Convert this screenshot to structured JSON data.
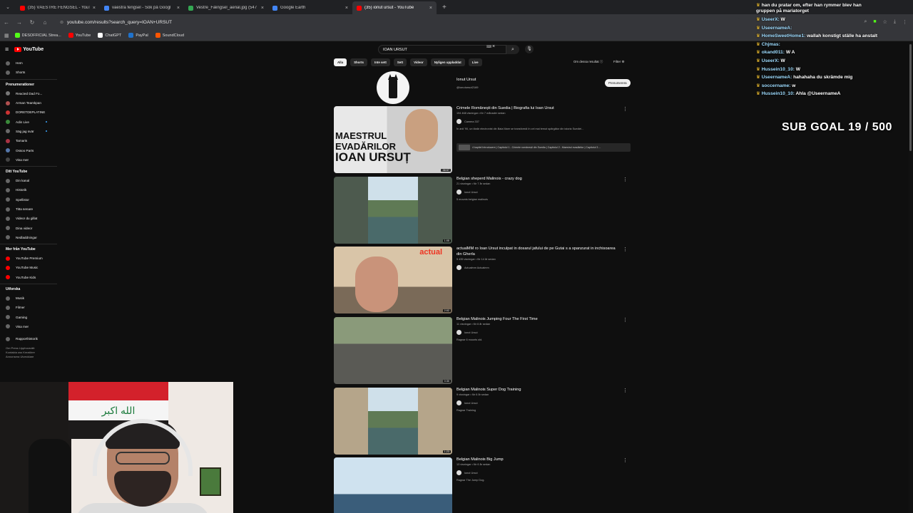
{
  "browser": {
    "tabs": [
      {
        "label": "(35) VÄESTRE FENGSEL - YouTu",
        "color": "#ff0000",
        "active": false
      },
      {
        "label": "vaestra fengsel - Sök på Googl",
        "color": "#4285f4",
        "active": false
      },
      {
        "label": "Vestre_Fængsel_aerial.jpg (547",
        "color": "#34a853",
        "active": false
      },
      {
        "label": "Google Earth",
        "color": "#4285f4",
        "active": false
      },
      {
        "label": "(35) ionut ursut - YouTube",
        "color": "#ff0000",
        "active": true
      }
    ],
    "new_tab": "+",
    "url": "youtube.com/results?search_query=IOAN+URSUT",
    "bookmarks": [
      {
        "label": "DESOFFICIAL Strea...",
        "color": "#53fc18"
      },
      {
        "label": "YouTube",
        "color": "#ff0000"
      },
      {
        "label": "ChatGPT",
        "color": "#ffffff"
      },
      {
        "label": "PayPal",
        "color": "#1f72cc"
      },
      {
        "label": "SoundCloud",
        "color": "#ff5500"
      }
    ]
  },
  "youtube": {
    "logo": "YouTube",
    "search_value": "IOAN URSUT",
    "sidebar_top": [
      {
        "label": "Hem"
      },
      {
        "label": "Shorts"
      }
    ],
    "subs_heading": "Prenumerationer",
    "subs": [
      {
        "label": "Reacted Dad Fo...",
        "color": "#777777"
      },
      {
        "label": "Arman Teamkpan",
        "color": "#b05050"
      },
      {
        "label": "DORETDEPLATINE",
        "color": "#cc3333"
      },
      {
        "label": "Adin Live",
        "color": "#3a8a3a"
      },
      {
        "label": "Säg jag svär",
        "color": "#6a6a6a"
      },
      {
        "label": "Tamaris",
        "color": "#aa3344"
      },
      {
        "label": "Ossoo Parts",
        "color": "#5577aa"
      },
      {
        "label": "Visa mer",
        "color": "#444444"
      }
    ],
    "you_heading": "Ditt YouTube",
    "you_items": [
      {
        "label": "Din kanal"
      },
      {
        "label": "Historik"
      },
      {
        "label": "Spellistor"
      },
      {
        "label": "Titta senare"
      },
      {
        "label": "Videor du gillat"
      },
      {
        "label": "Dina videor"
      },
      {
        "label": "Nedladdningar"
      }
    ],
    "more_heading": "Mer från YouTube",
    "more_items": [
      {
        "label": "YouTube Premium"
      },
      {
        "label": "YouTube Music"
      },
      {
        "label": "YouTube Kids"
      }
    ],
    "explore_heading": "Utforska",
    "explore_items": [
      {
        "label": "Musik"
      },
      {
        "label": "Filmer"
      },
      {
        "label": "Gaming"
      },
      {
        "label": "Visa mer"
      }
    ],
    "report_label": "Rapporthistorik",
    "footer": "Om  Press  Upphovsrätt  Kontakta oss  Kreatörer  Annonsera  Utvecklare",
    "chips": [
      "Alla",
      "Shorts",
      "Inte sett",
      "Sett",
      "Videor",
      "Nyligen uppladdat",
      "Live"
    ],
    "about_results": "Om dessa resultat",
    "filter_label": "Filter",
    "channel": {
      "name": "Ionut Ursut",
      "handle": "@ionutursut2169",
      "subscribe_label": "Prenumerera"
    },
    "videos": [
      {
        "title": "Crimele Românești din Suedia | Biografia lui Ioan Ursut",
        "meta": "194 468 visningar • för 7 månader sedan",
        "channel": "Camera 337",
        "desc": "În anii '90, un tânăr electronist din Baia Mare se transformă în cel mai temut spărgător din istoria Suediei...",
        "duration": "38:57",
        "thumb_text": [
          "MAESTRUL",
          "EVADĂRILOR",
          "IOAN URSUȚ"
        ],
        "chapters": "4 kapitel  Introducere | Capitolul 1 - Crimele românești din Suedia | Capitolul 2 - Maestrul evadărilor | Capitolul 3 ..."
      },
      {
        "title": "Belgian sheperd Malinois - crazy dog",
        "meta": "21 visningar • för 7 år sedan",
        "channel": "Ionut Ursut",
        "desc": "5 mounts belgian malinois",
        "duration": "1:05"
      },
      {
        "title": "actualMM ro Ioan Ursut inculpat in dosarul jafului de pe Gutai s a spanzurat in inchisoarea din Gherla",
        "meta": "5 435 visningar • för 14 år sedan",
        "channel": "Actualmm Actualmm",
        "desc": "",
        "duration": "2:02",
        "thumb_text": [
          "actual"
        ]
      },
      {
        "title": "Belgian Malinois Jumping Four The First Time",
        "meta": "11 visningar • för 6 år sedan",
        "channel": "Ionut Ursut",
        "desc": "Ragnar 6 mounts old.",
        "duration": "0:30"
      },
      {
        "title": "Belgian Malinois Super Dog Training",
        "meta": "9 visningar • för 6 år sedan",
        "channel": "Ionut Ursut",
        "desc": "Ragnar Training",
        "duration": "1:23"
      },
      {
        "title": "Belgian Malinois Big Jump",
        "meta": "13 visningar • för 6 år sedan",
        "channel": "Ionut Ursut",
        "desc": "Ragnar The Jump Dog.",
        "duration": ""
      }
    ]
  },
  "chat": {
    "messages": [
      {
        "user": "",
        "text": "han du pratar om, efter han rymmer blev han",
        "cont": "gruppen på mariatorget"
      },
      {
        "user": "UseerX:",
        "text": "W",
        "cont": ""
      },
      {
        "user": "UseernameA:",
        "text": "",
        "cont": ""
      },
      {
        "user": "HomeSweetHome1:",
        "text": "wallah konstigt ställe ha anstalt",
        "cont": ""
      },
      {
        "user": "Chjmas:",
        "text": "",
        "cont": ""
      },
      {
        "user": "okand011:",
        "text": "W A",
        "cont": ""
      },
      {
        "user": "UseerX:",
        "text": "W",
        "cont": ""
      },
      {
        "user": "Hussein10_10:",
        "text": "W",
        "cont": ""
      },
      {
        "user": "UseernameA:",
        "text": "hahahaha du skrämde mig",
        "cont": ""
      },
      {
        "user": "soccername:",
        "text": "w",
        "cont": ""
      },
      {
        "user": "Hussein10_10:",
        "text": "Ahla @UseernameA",
        "cont": ""
      }
    ],
    "sub_goal": "SUB GOAL 19 / 500"
  },
  "colors": {
    "bg": "#0f0f0f",
    "chrome": "#35363a",
    "accent": "#ff0000"
  }
}
